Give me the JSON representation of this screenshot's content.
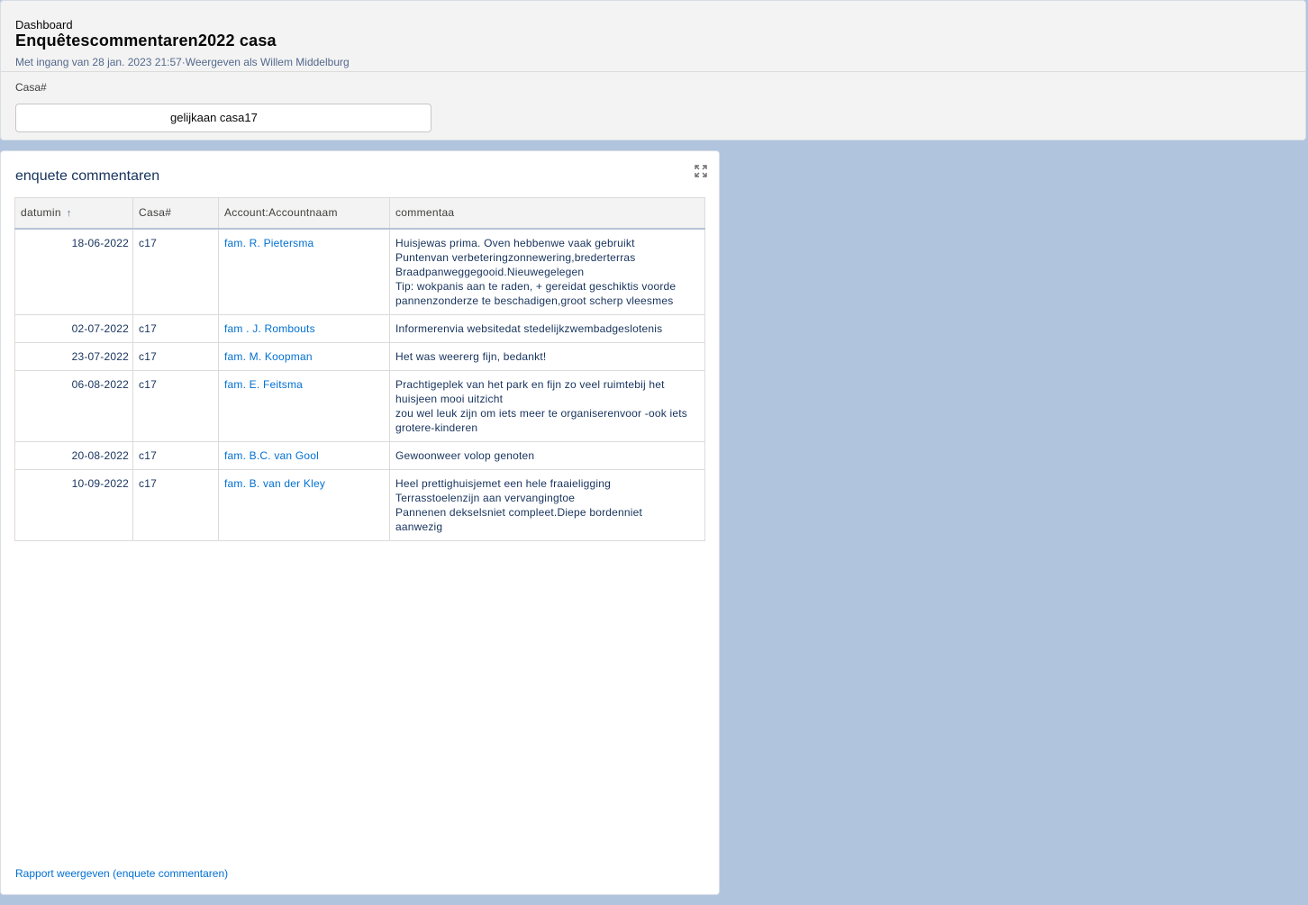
{
  "header": {
    "eyebrow": "Dashboard",
    "title": "Enquêtescommentaren2022 casa",
    "subtitle": "Met ingang van 28 jan. 2023 21:57·Weergeven als Willem Middelburg"
  },
  "filter": {
    "label": "Casa#",
    "value": "gelijkaan casa17"
  },
  "card": {
    "title": "enquete commentaren",
    "expand_icon": "expand-icon",
    "footer_link": "Rapport weergeven (enquete commentaren)"
  },
  "table": {
    "columns": [
      {
        "label": "datumin",
        "sort": "↑"
      },
      {
        "label": "Casa#"
      },
      {
        "label": "Account:Accountnaam"
      },
      {
        "label": "commentaa"
      }
    ],
    "rows": [
      {
        "date": "18-06-2022",
        "casa": "c17",
        "account": "fam. R. Pietersma",
        "comment": [
          "Huisjewas prima. Oven hebbenwe vaak gebruikt",
          "Puntenvan verbeteringzonnewering,brederterras",
          "Braadpanweggegooid.Nieuwegelegen",
          "Tip: wokpanis aan te raden, + gereidat geschiktis voorde",
          "pannenzonderze te beschadigen,groot scherp vleesmes"
        ]
      },
      {
        "date": "02-07-2022",
        "casa": "c17",
        "account": "fam . J. Rombouts",
        "comment": [
          "Informerenvia websitedat stedelijkzwembadgeslotenis"
        ]
      },
      {
        "date": "23-07-2022",
        "casa": "c17",
        "account": "fam. M. Koopman",
        "comment": [
          "Het was weererg fijn, bedankt!"
        ]
      },
      {
        "date": "06-08-2022",
        "casa": "c17",
        "account": "fam. E. Feitsma",
        "comment": [
          "Prachtigeplek van het park en fijn zo veel ruimtebij het",
          "huisjeen mooi uitzicht",
          "zou wel leuk zijn om iets meer te organiserenvoor -ook iets",
          "grotere-kinderen"
        ]
      },
      {
        "date": "20-08-2022",
        "casa": "c17",
        "account": "fam. B.C. van Gool",
        "comment": [
          "Gewoonweer volop genoten"
        ]
      },
      {
        "date": "10-09-2022",
        "casa": "c17",
        "account": "fam. B. van der Kley",
        "comment": [
          "Heel prettighuisjemet een hele fraaieligging",
          "Terrasstoelenzijn aan vervangingtoe",
          "Pannenen dekselsniet compleet.Diepe bordenniet",
          "aanwezig"
        ]
      }
    ]
  },
  "colors": {
    "background": "#b0c4de",
    "link": "#0070d2",
    "text": "#16325c"
  }
}
